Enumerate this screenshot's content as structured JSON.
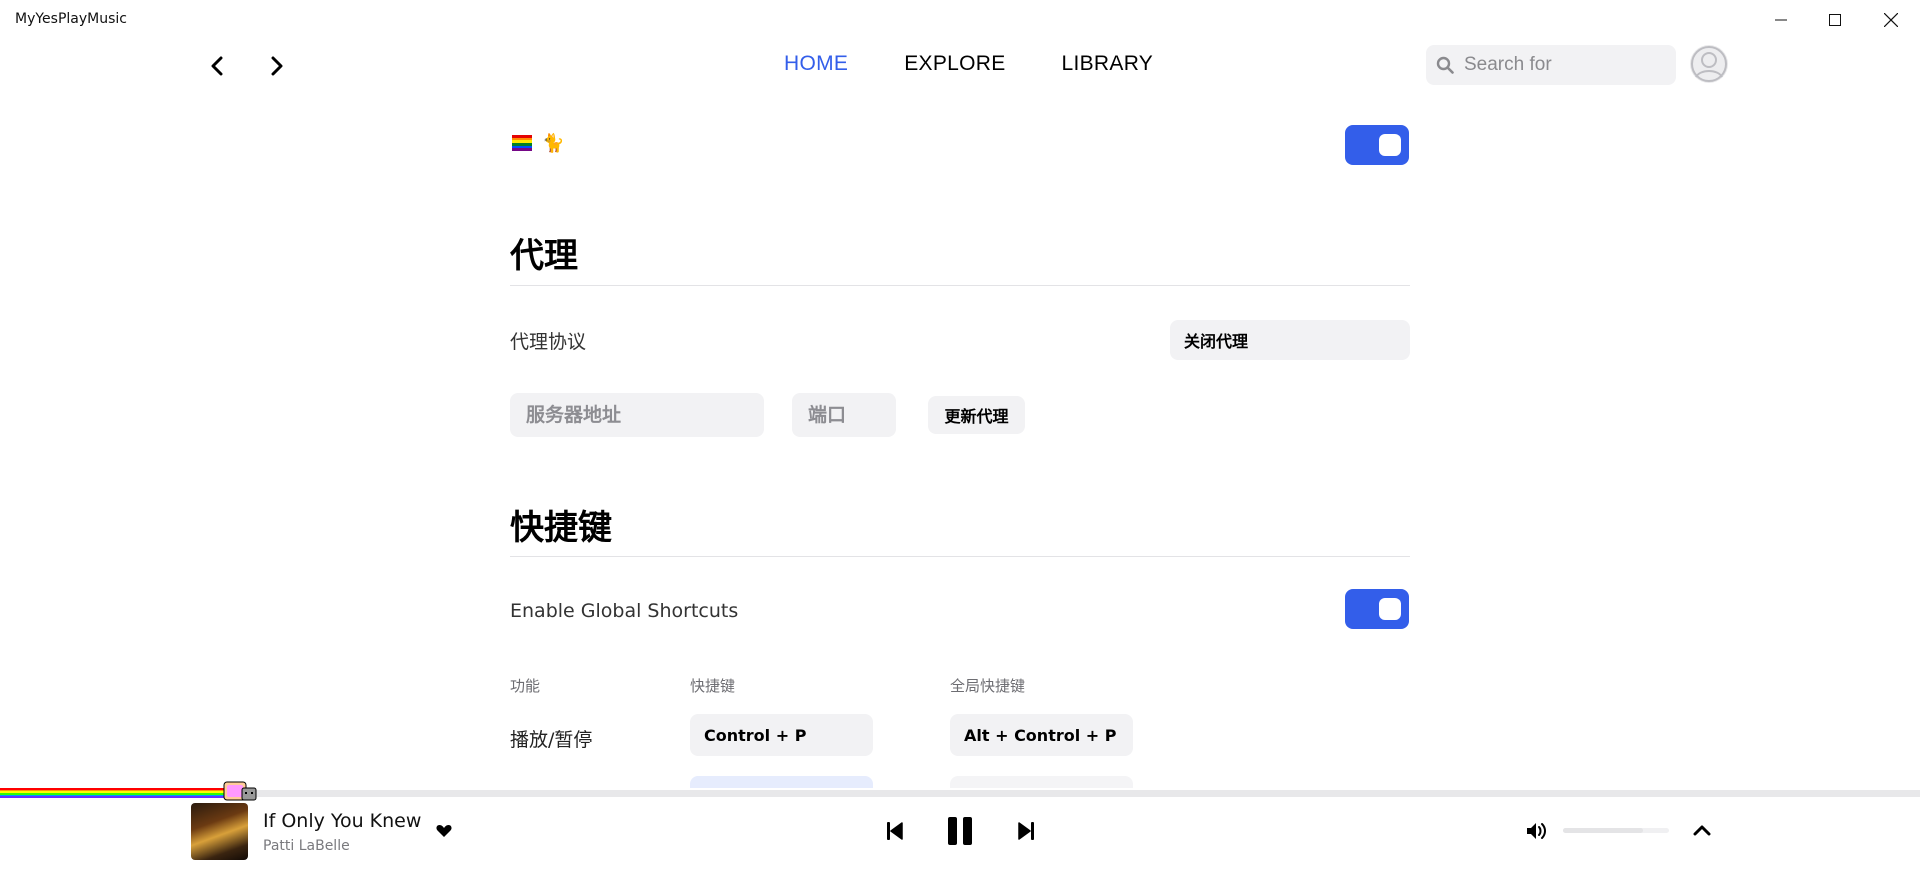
{
  "window": {
    "title": "MyYesPlayMusic",
    "minimize_icon": "minimize-icon",
    "maximize_icon": "maximize-icon",
    "close_icon": "close-icon"
  },
  "nav": {
    "back_icon": "chevron-left-icon",
    "forward_icon": "chevron-right-icon",
    "tabs": [
      {
        "label": "HOME",
        "active": true
      },
      {
        "label": "EXPLORE",
        "active": false
      },
      {
        "label": "LIBRARY",
        "active": false
      }
    ],
    "search_placeholder": "Search for",
    "search_icon": "search-icon",
    "avatar_icon": "avatar-icon"
  },
  "top_row": {
    "flag_icon": "rainbow-flag-icon",
    "cat_icon": "cat-icon",
    "toggle_on": true
  },
  "proxy": {
    "title": "代理",
    "protocol_label": "代理协议",
    "protocol_value": "关闭代理",
    "server_placeholder": "服务器地址",
    "port_placeholder": "端口",
    "update_button": "更新代理"
  },
  "shortcuts": {
    "title": "快捷键",
    "enable_label": "Enable Global Shortcuts",
    "enable_on": true,
    "columns": [
      "功能",
      "快捷键",
      "全局快捷键"
    ],
    "rows": [
      {
        "function": "播放/暂停",
        "shortcut": "Control + P",
        "global": "Alt + Control + P"
      }
    ]
  },
  "player": {
    "track_title": "If Only You Knew",
    "artist": "Patti LaBelle",
    "like_icon": "heart-icon",
    "prev_icon": "skip-previous-icon",
    "pause_icon": "pause-icon",
    "next_icon": "skip-next-icon",
    "volume_icon": "volume-icon",
    "expand_icon": "chevron-up-icon",
    "progress_fraction": 0.12,
    "volume_fraction": 0.75
  },
  "colors": {
    "accent": "#335eea",
    "field_bg": "#f2f2f4"
  }
}
